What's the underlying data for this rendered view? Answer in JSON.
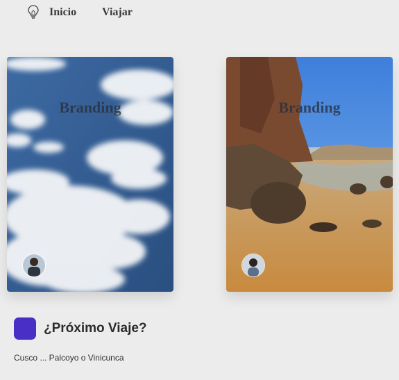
{
  "nav": {
    "icon": "lightbulb-icon",
    "items": [
      {
        "label": "Inicio"
      },
      {
        "label": "Viajar"
      }
    ]
  },
  "cards": [
    {
      "title": "Branding",
      "image": "sky-clouds-photo",
      "avatar": "traveler-avatar"
    },
    {
      "title": "Branding",
      "image": "beach-rocks-photo",
      "avatar": "traveler-avatar"
    }
  ],
  "next_trip": {
    "heading": "¿Próximo Viaje?",
    "description": "Cusco ... Palcoyo o Vinicunca",
    "accent": "#4a2fc6"
  }
}
